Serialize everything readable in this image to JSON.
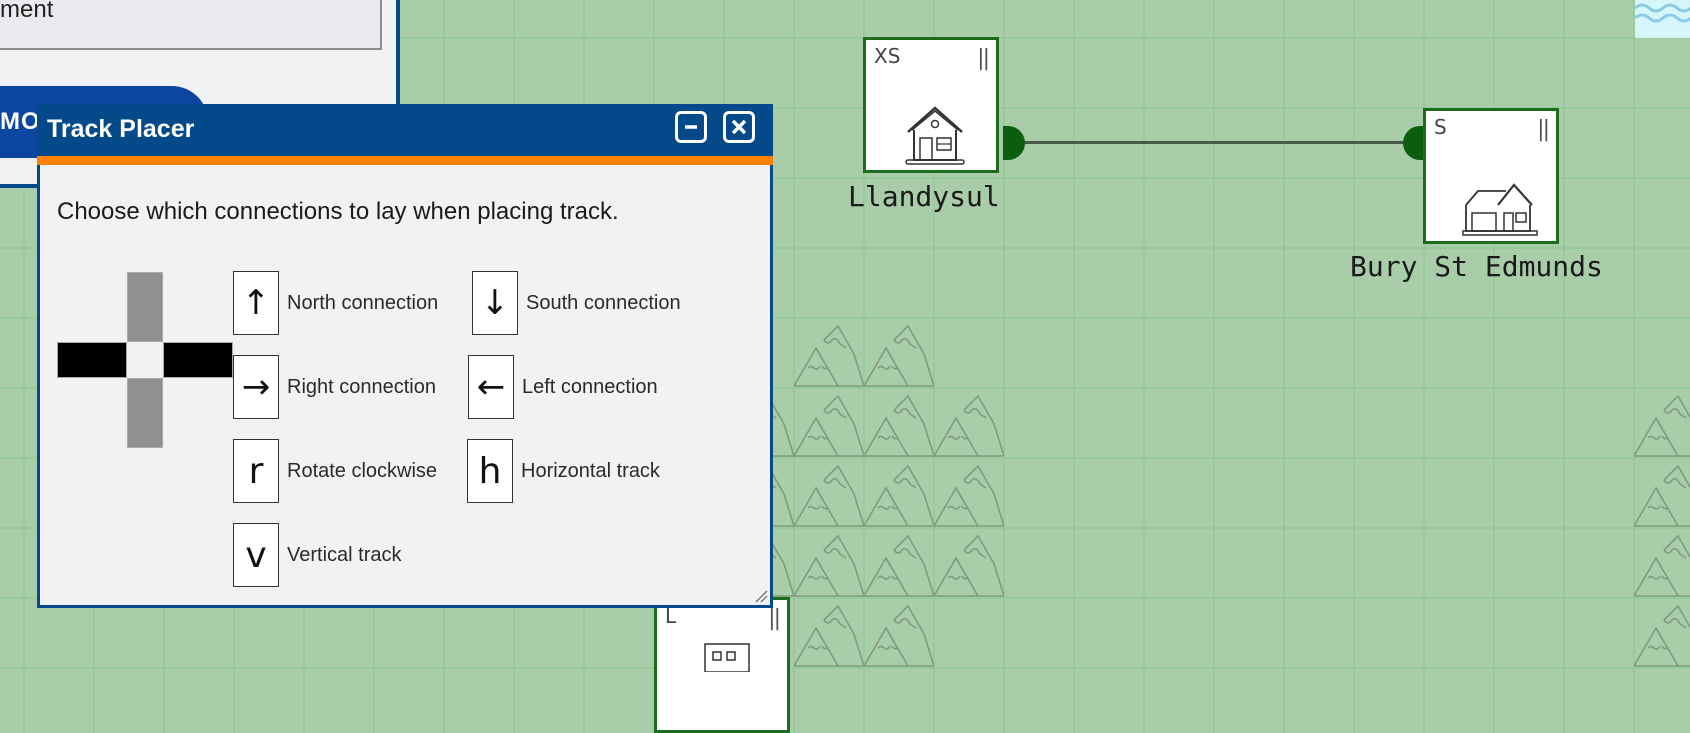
{
  "background_panel": {
    "input_text_fragment": "ment",
    "button_text_fragment": "MOV"
  },
  "dialog": {
    "title": "Track Placer",
    "minimize_label": "−",
    "close_label": "×",
    "instructions": "Choose which connections to lay when placing track.",
    "preview": {
      "north": "inactive",
      "south": "inactive",
      "east": "active",
      "west": "active"
    },
    "keys": [
      {
        "key": "↑",
        "label": "North connection",
        "icon": "arrow-up-icon"
      },
      {
        "key": "↓",
        "label": "South connection",
        "icon": "arrow-down-icon"
      },
      {
        "key": "→",
        "label": "Right connection",
        "icon": "arrow-right-icon"
      },
      {
        "key": "←",
        "label": "Left connection",
        "icon": "arrow-left-icon"
      },
      {
        "key": "r",
        "label": "Rotate clockwise",
        "icon": "key-r-icon"
      },
      {
        "key": "h",
        "label": "Horizontal track",
        "icon": "key-h-icon"
      },
      {
        "key": "v",
        "label": "Vertical track",
        "icon": "key-v-icon"
      }
    ]
  },
  "map": {
    "stations": [
      {
        "name": "Llandysul",
        "size": "XS",
        "status_icon": "pause-icon",
        "building": "house-icon"
      },
      {
        "name": "Bury St Edmunds",
        "size": "S",
        "status_icon": "pause-icon",
        "building": "house-garage-icon"
      },
      {
        "name": "",
        "size": "L",
        "status_icon": "pause-icon",
        "building": "building-icon"
      }
    ],
    "connections": [
      {
        "from": "Llandysul",
        "to": "Bury St Edmunds"
      }
    ],
    "terrain": [
      "mountains",
      "water"
    ],
    "colors": {
      "grass": "#a8cda8",
      "station_border": "#1e6b1e",
      "connector": "#0b5e0b",
      "dialog_header": "#04498a",
      "dialog_accent": "#ff8000",
      "water": "#d6f6fb"
    }
  }
}
